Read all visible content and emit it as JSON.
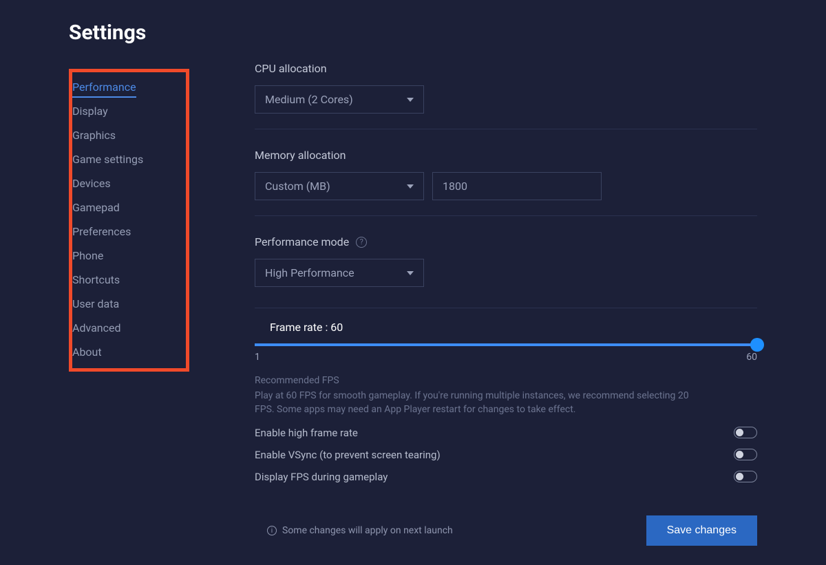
{
  "title": "Settings",
  "sidebar": {
    "items": [
      {
        "label": "Performance",
        "active": true
      },
      {
        "label": "Display"
      },
      {
        "label": "Graphics"
      },
      {
        "label": "Game settings"
      },
      {
        "label": "Devices"
      },
      {
        "label": "Gamepad"
      },
      {
        "label": "Preferences"
      },
      {
        "label": "Phone"
      },
      {
        "label": "Shortcuts"
      },
      {
        "label": "User data"
      },
      {
        "label": "Advanced"
      },
      {
        "label": "About"
      }
    ]
  },
  "cpu": {
    "label": "CPU allocation",
    "value": "Medium (2 Cores)"
  },
  "memory": {
    "label": "Memory allocation",
    "mode": "Custom (MB)",
    "value": "1800"
  },
  "perfMode": {
    "label": "Performance mode",
    "value": "High Performance"
  },
  "fps": {
    "label": "Frame rate : 60",
    "min": "1",
    "max": "60",
    "recHeader": "Recommended FPS",
    "recText": "Play at 60 FPS for smooth gameplay. If you're running multiple instances, we recommend selecting 20 FPS. Some apps may need an App Player restart for changes to take effect."
  },
  "toggles": {
    "hfr": "Enable high frame rate",
    "vsync": "Enable VSync (to prevent screen tearing)",
    "showFps": "Display FPS during gameplay"
  },
  "footer": {
    "note": "Some changes will apply on next launch",
    "save": "Save changes"
  }
}
